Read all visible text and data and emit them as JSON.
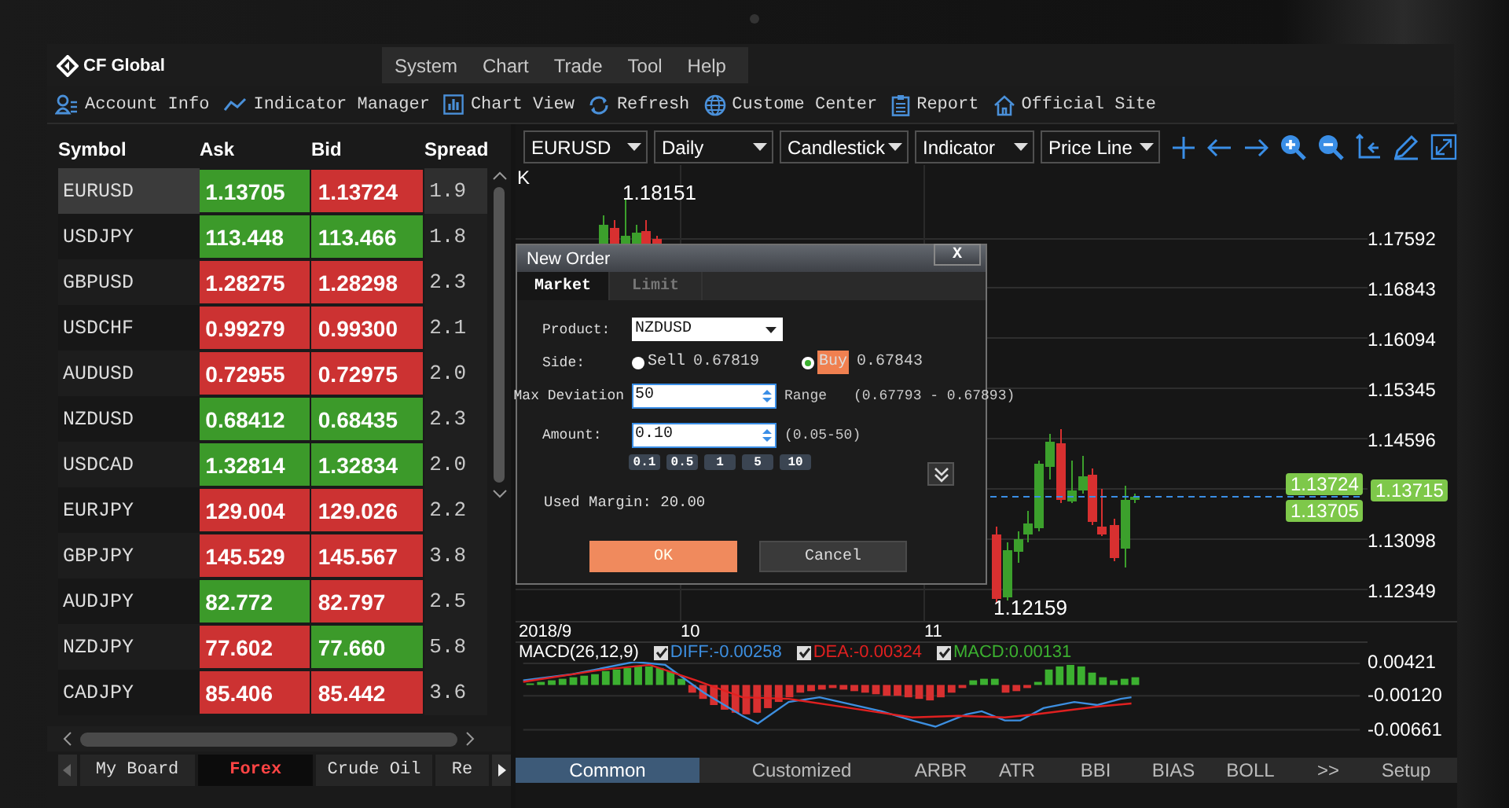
{
  "app": {
    "logo": "CF Global",
    "menu": [
      "System",
      "Chart",
      "Trade",
      "Tool",
      "Help"
    ],
    "toolbar": [
      "Account Info",
      "Indicator Manager",
      "Chart View",
      "Refresh",
      "Custome Center",
      "Report",
      "Official Site"
    ]
  },
  "quotes": {
    "columns": [
      "Symbol",
      "Ask",
      "Bid",
      "Spread"
    ],
    "rows": [
      {
        "symbol": "EURUSD",
        "ask": "1.13705",
        "ask_up": true,
        "bid": "1.13724",
        "bid_up": false,
        "spread": "1.9",
        "selected": true
      },
      {
        "symbol": "USDJPY",
        "ask": "113.448",
        "ask_up": true,
        "bid": "113.466",
        "bid_up": true,
        "spread": "1.8",
        "selected": false
      },
      {
        "symbol": "GBPUSD",
        "ask": "1.28275",
        "ask_up": false,
        "bid": "1.28298",
        "bid_up": false,
        "spread": "2.3",
        "selected": false
      },
      {
        "symbol": "USDCHF",
        "ask": "0.99279",
        "ask_up": false,
        "bid": "0.99300",
        "bid_up": false,
        "spread": "2.1",
        "selected": false
      },
      {
        "symbol": "AUDUSD",
        "ask": "0.72955",
        "ask_up": false,
        "bid": "0.72975",
        "bid_up": false,
        "spread": "2.0",
        "selected": false
      },
      {
        "symbol": "NZDUSD",
        "ask": "0.68412",
        "ask_up": true,
        "bid": "0.68435",
        "bid_up": true,
        "spread": "2.3",
        "selected": false
      },
      {
        "symbol": "USDCAD",
        "ask": "1.32814",
        "ask_up": true,
        "bid": "1.32834",
        "bid_up": true,
        "spread": "2.0",
        "selected": false
      },
      {
        "symbol": "EURJPY",
        "ask": "129.004",
        "ask_up": false,
        "bid": "129.026",
        "bid_up": false,
        "spread": "2.2",
        "selected": false
      },
      {
        "symbol": "GBPJPY",
        "ask": "145.529",
        "ask_up": false,
        "bid": "145.567",
        "bid_up": false,
        "spread": "3.8",
        "selected": false
      },
      {
        "symbol": "AUDJPY",
        "ask": "82.772",
        "ask_up": true,
        "bid": "82.797",
        "bid_up": false,
        "spread": "2.5",
        "selected": false
      },
      {
        "symbol": "NZDJPY",
        "ask": "77.602",
        "ask_up": false,
        "bid": "77.660",
        "bid_up": true,
        "spread": "5.8",
        "selected": false
      },
      {
        "symbol": "CADJPY",
        "ask": "85.406",
        "ask_up": false,
        "bid": "85.442",
        "bid_up": false,
        "spread": "3.6",
        "selected": false
      }
    ],
    "tabs": [
      {
        "label": "My Board",
        "selected": false
      },
      {
        "label": "Forex",
        "selected": true
      },
      {
        "label": "Crude Oil",
        "selected": false
      },
      {
        "label": "Re",
        "selected": false
      }
    ]
  },
  "chart": {
    "selectors": [
      "EURUSD",
      "Daily",
      "Candlestick",
      "Indicator",
      "Price Line"
    ],
    "series_label": "K",
    "high_label": "1.18151",
    "low_label": "1.12159",
    "price_axis": [
      "1.17592",
      "1.16843",
      "1.16094",
      "1.15345",
      "1.14596",
      "1.13098",
      "1.12349"
    ],
    "ask_tag": "1.13724",
    "bid_tag": "1.13705",
    "last_tag": "1.13715",
    "time_axis": [
      "2018/9",
      "10",
      "11"
    ],
    "macd": {
      "title": "MACD(26,12,9)",
      "legend": [
        {
          "label": "DIFF:-0.00258",
          "color": "#3d8fe0",
          "checked": true
        },
        {
          "label": "DEA:-0.00324",
          "color": "#e02020",
          "checked": true
        },
        {
          "label": "MACD:0.00131",
          "color": "#3cb030",
          "checked": true
        }
      ],
      "axis": [
        "0.00421",
        "-0.00120",
        "-0.00661"
      ]
    },
    "indicator_tabs": [
      {
        "label": "Common",
        "selected": true
      },
      {
        "label": "Customized",
        "selected": false
      },
      {
        "label": "ARBR",
        "selected": false
      },
      {
        "label": "ATR",
        "selected": false
      },
      {
        "label": "BBI",
        "selected": false
      },
      {
        "label": "BIAS",
        "selected": false
      },
      {
        "label": "BOLL",
        "selected": false
      },
      {
        "label": ">>",
        "selected": false
      },
      {
        "label": "Setup",
        "selected": false
      }
    ]
  },
  "dialog": {
    "title": "New Order",
    "close": "X",
    "tabs": [
      {
        "label": "Market",
        "selected": true
      },
      {
        "label": "Limit",
        "selected": false
      }
    ],
    "product_label": "Product:",
    "product": "NZDUSD",
    "side_label": "Side:",
    "sides": [
      {
        "label": "Sell",
        "price": "0.67819",
        "selected": false
      },
      {
        "label": "Buy",
        "price": "0.67843",
        "selected": true
      }
    ],
    "deviation_label": "Max Deviation",
    "deviation": "50",
    "range_label": "Range",
    "range": "(0.67793 - 0.67893)",
    "amount_label": "Amount:",
    "amount": "0.10",
    "amount_range": "(0.05-50)",
    "presets": [
      "0.1",
      "0.5",
      "1",
      "5",
      "10"
    ],
    "margin": "Used Margin: 20.00",
    "buttons": [
      {
        "label": "OK",
        "kind": "primary"
      },
      {
        "label": "Cancel",
        "kind": "secondary"
      }
    ]
  }
}
